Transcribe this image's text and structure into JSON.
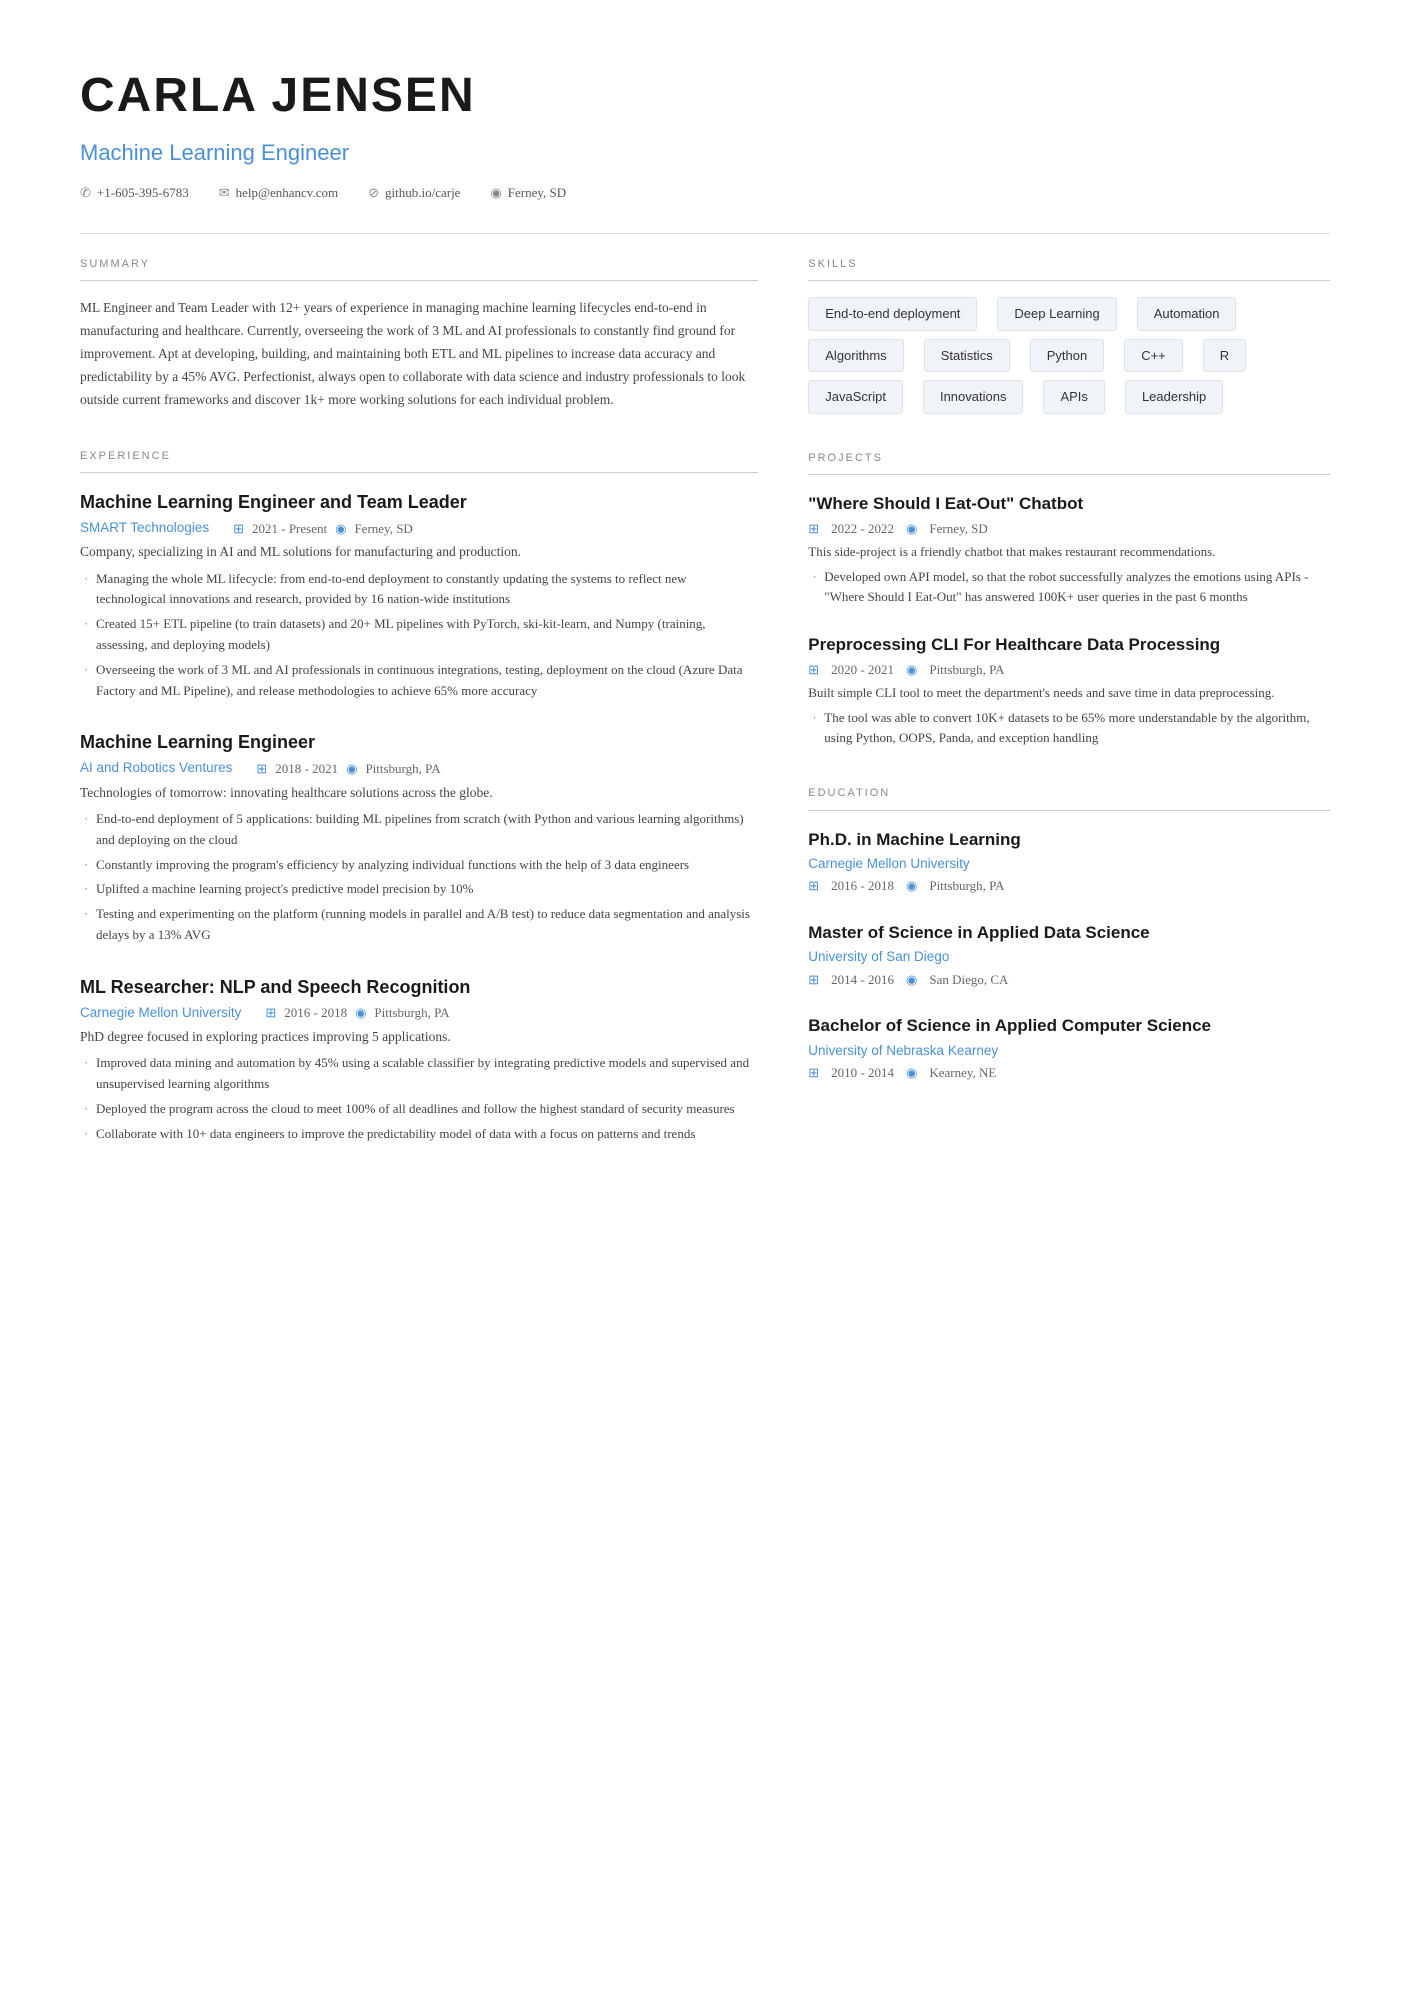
{
  "header": {
    "name": "CARLA JENSEN",
    "title": "Machine Learning Engineer",
    "contact": {
      "phone": "+1-605-395-6783",
      "email": "help@enhancv.com",
      "web": "github.io/carje",
      "location": "Ferney, SD"
    }
  },
  "summary": {
    "section_title": "SUMMARY",
    "text": "ML Engineer and Team Leader with 12+ years of experience in managing machine learning lifecycles end-to-end in manufacturing and healthcare. Currently, overseeing the work of 3 ML and AI professionals to constantly find ground for improvement. Apt at developing, building, and maintaining both ETL and ML pipelines to increase data accuracy and predictability by a 45% AVG. Perfectionist, always open to collaborate with data science and industry professionals to look outside current frameworks and discover 1k+ more working solutions for each individual problem."
  },
  "experience": {
    "section_title": "EXPERIENCE",
    "items": [
      {
        "title": "Machine Learning Engineer and Team Leader",
        "company": "SMART Technologies",
        "date": "2021 - Present",
        "location": "Ferney, SD",
        "description": "Company, specializing in AI and ML solutions for manufacturing and production.",
        "bullets": [
          "Managing the whole ML lifecycle: from end-to-end deployment to constantly updating the systems to reflect new technological innovations and research, provided by 16 nation-wide institutions",
          "Created 15+ ETL pipeline (to train datasets) and 20+ ML pipelines with PyTorch, ski-kit-learn, and Numpy (training, assessing, and deploying models)",
          "Overseeing the work of 3 ML and AI professionals in continuous integrations, testing, deployment on the cloud (Azure Data Factory and ML Pipeline), and release methodologies to achieve 65% more accuracy"
        ]
      },
      {
        "title": "Machine Learning Engineer",
        "company": "AI and Robotics Ventures",
        "date": "2018 - 2021",
        "location": "Pittsburgh, PA",
        "description": "Technologies of tomorrow: innovating healthcare solutions across the globe.",
        "bullets": [
          "End-to-end deployment of 5 applications: building ML pipelines from scratch (with Python and various learning algorithms) and deploying on the cloud",
          "Constantly improving the program's efficiency by analyzing individual functions with the help of 3 data engineers",
          "Uplifted a machine learning project's predictive model precision by 10%",
          "Testing and experimenting on the platform (running models in parallel and A/B test) to reduce data segmentation and analysis delays by a 13% AVG"
        ]
      },
      {
        "title": "ML Researcher: NLP and Speech Recognition",
        "company": "Carnegie Mellon University",
        "date": "2016 - 2018",
        "location": "Pittsburgh, PA",
        "description": "PhD degree focused in exploring practices improving 5 applications.",
        "bullets": [
          "Improved data mining and automation by 45% using a scalable classifier by integrating predictive models and supervised and unsupervised learning algorithms",
          "Deployed the program across the cloud to meet 100% of all deadlines and follow the highest standard of security measures",
          "Collaborate with 10+ data engineers to improve the predictability model of data with a focus on patterns and trends"
        ]
      }
    ]
  },
  "skills": {
    "section_title": "SKILLS",
    "items": [
      "End-to-end deployment",
      "Deep Learning",
      "Automation",
      "Algorithms",
      "Statistics",
      "Python",
      "C++",
      "R",
      "JavaScript",
      "Innovations",
      "APIs",
      "Leadership"
    ]
  },
  "projects": {
    "section_title": "PROJECTS",
    "items": [
      {
        "title": "\"Where Should I Eat-Out\" Chatbot",
        "date": "2022 - 2022",
        "location": "Ferney, SD",
        "description": "This side-project is a friendly chatbot that makes restaurant recommendations.",
        "bullets": [
          "Developed own API model, so that the robot successfully analyzes the emotions using APIs - \"Where Should I Eat-Out\" has answered 100K+ user queries in the past 6 months"
        ]
      },
      {
        "title": "Preprocessing CLI For Healthcare Data Processing",
        "date": "2020 - 2021",
        "location": "Pittsburgh, PA",
        "description": "Built simple CLI tool to meet the department's needs and save time in data preprocessing.",
        "bullets": [
          "The tool was able to convert 10K+ datasets to be 65% more understandable by the algorithm, using Python, OOPS, Panda, and exception handling"
        ]
      }
    ]
  },
  "education": {
    "section_title": "EDUCATION",
    "items": [
      {
        "degree": "Ph.D. in Machine Learning",
        "school": "Carnegie Mellon University",
        "date": "2016 - 2018",
        "location": "Pittsburgh, PA"
      },
      {
        "degree": "Master of Science in Applied Data Science",
        "school": "University of San Diego",
        "date": "2014 - 2016",
        "location": "San Diego, CA"
      },
      {
        "degree": "Bachelor of Science in Applied Computer Science",
        "school": "University of Nebraska Kearney",
        "date": "2010 - 2014",
        "location": "Kearney, NE"
      }
    ]
  }
}
